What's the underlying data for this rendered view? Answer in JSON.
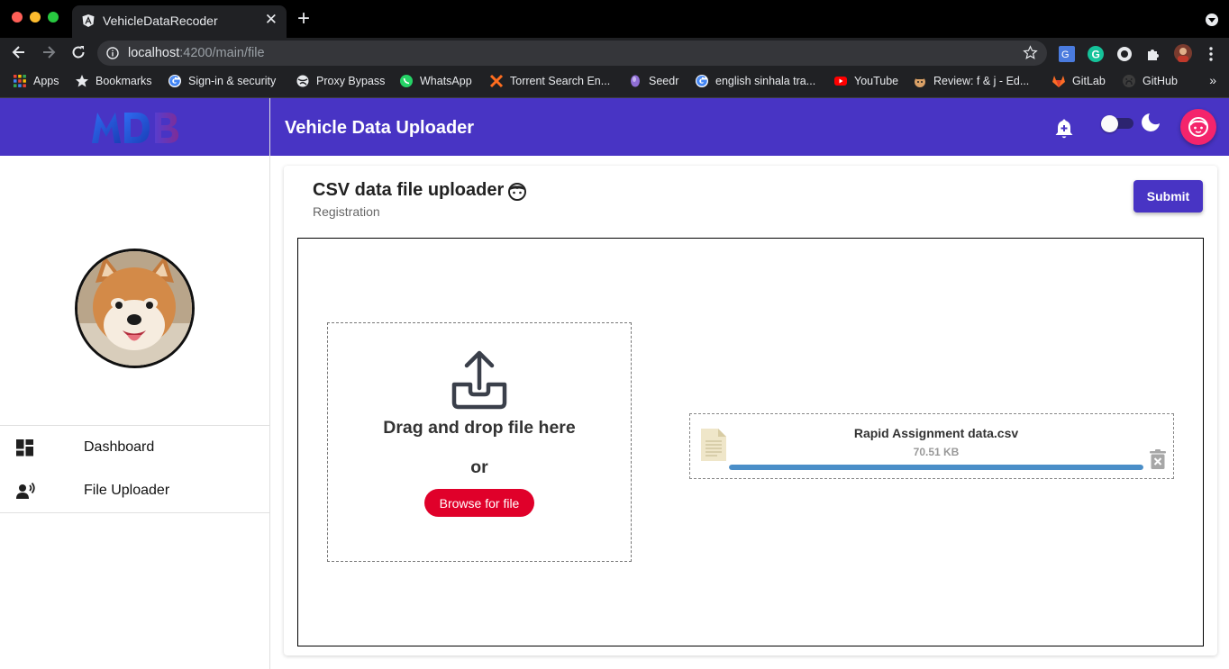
{
  "browser": {
    "tab_title": "VehicleDataRecoder",
    "tab_close": "✕",
    "new_tab": "+",
    "url_host": "localhost",
    "url_path": ":4200/main/file",
    "bookmarks_more": "»",
    "bookmarks": [
      {
        "label": "Apps",
        "icon": "apps-grid-icon",
        "color": "#e8453c"
      },
      {
        "label": "Bookmarks",
        "icon": "star-icon",
        "color": "#e8eaed"
      },
      {
        "label": "Sign-in & security",
        "icon": "google-icon",
        "color": "#4285f4"
      },
      {
        "label": "Proxy Bypass",
        "icon": "globe-icon",
        "color": "#e8eaed"
      },
      {
        "label": "WhatsApp",
        "icon": "whatsapp-icon",
        "color": "#25d366"
      },
      {
        "label": "Torrent Search En...",
        "icon": "x-logo-icon",
        "color": "#ff6d1f"
      },
      {
        "label": "Seedr",
        "icon": "seedr-icon",
        "color": "#8f6ed5"
      },
      {
        "label": "english sinhala tra...",
        "icon": "google-icon",
        "color": "#4285f4"
      },
      {
        "label": "YouTube",
        "icon": "youtube-icon",
        "color": "#ff0000"
      },
      {
        "label": "Review: f & j - Ed...",
        "icon": "avatar-icon",
        "color": "#d9a066"
      },
      {
        "label": "GitLab",
        "icon": "gitlab-icon",
        "color": "#fc6d26"
      },
      {
        "label": "GitHub",
        "icon": "github-icon",
        "color": "#e8eaed"
      }
    ]
  },
  "sidebar": {
    "logo_text": "MDB",
    "nav": [
      {
        "label": "Dashboard",
        "icon": "dashboard-icon"
      },
      {
        "label": "File Uploader",
        "icon": "record-voice-icon"
      }
    ]
  },
  "appbar": {
    "title": "Vehicle Data Uploader"
  },
  "card": {
    "title": "CSV data file uploader",
    "subtitle": "Registration",
    "submit_label": "Submit"
  },
  "dropzone": {
    "text": "Drag and drop file here",
    "or_text": "or",
    "browse_label": "Browse for file"
  },
  "file": {
    "name": "Rapid Assignment data.csv",
    "size": "70.51 KB",
    "progress": 1.0
  },
  "colors": {
    "primary": "#4834c4",
    "accent": "#f4246c",
    "browse_button": "#e0002a",
    "progress": "#4a8ec8"
  }
}
